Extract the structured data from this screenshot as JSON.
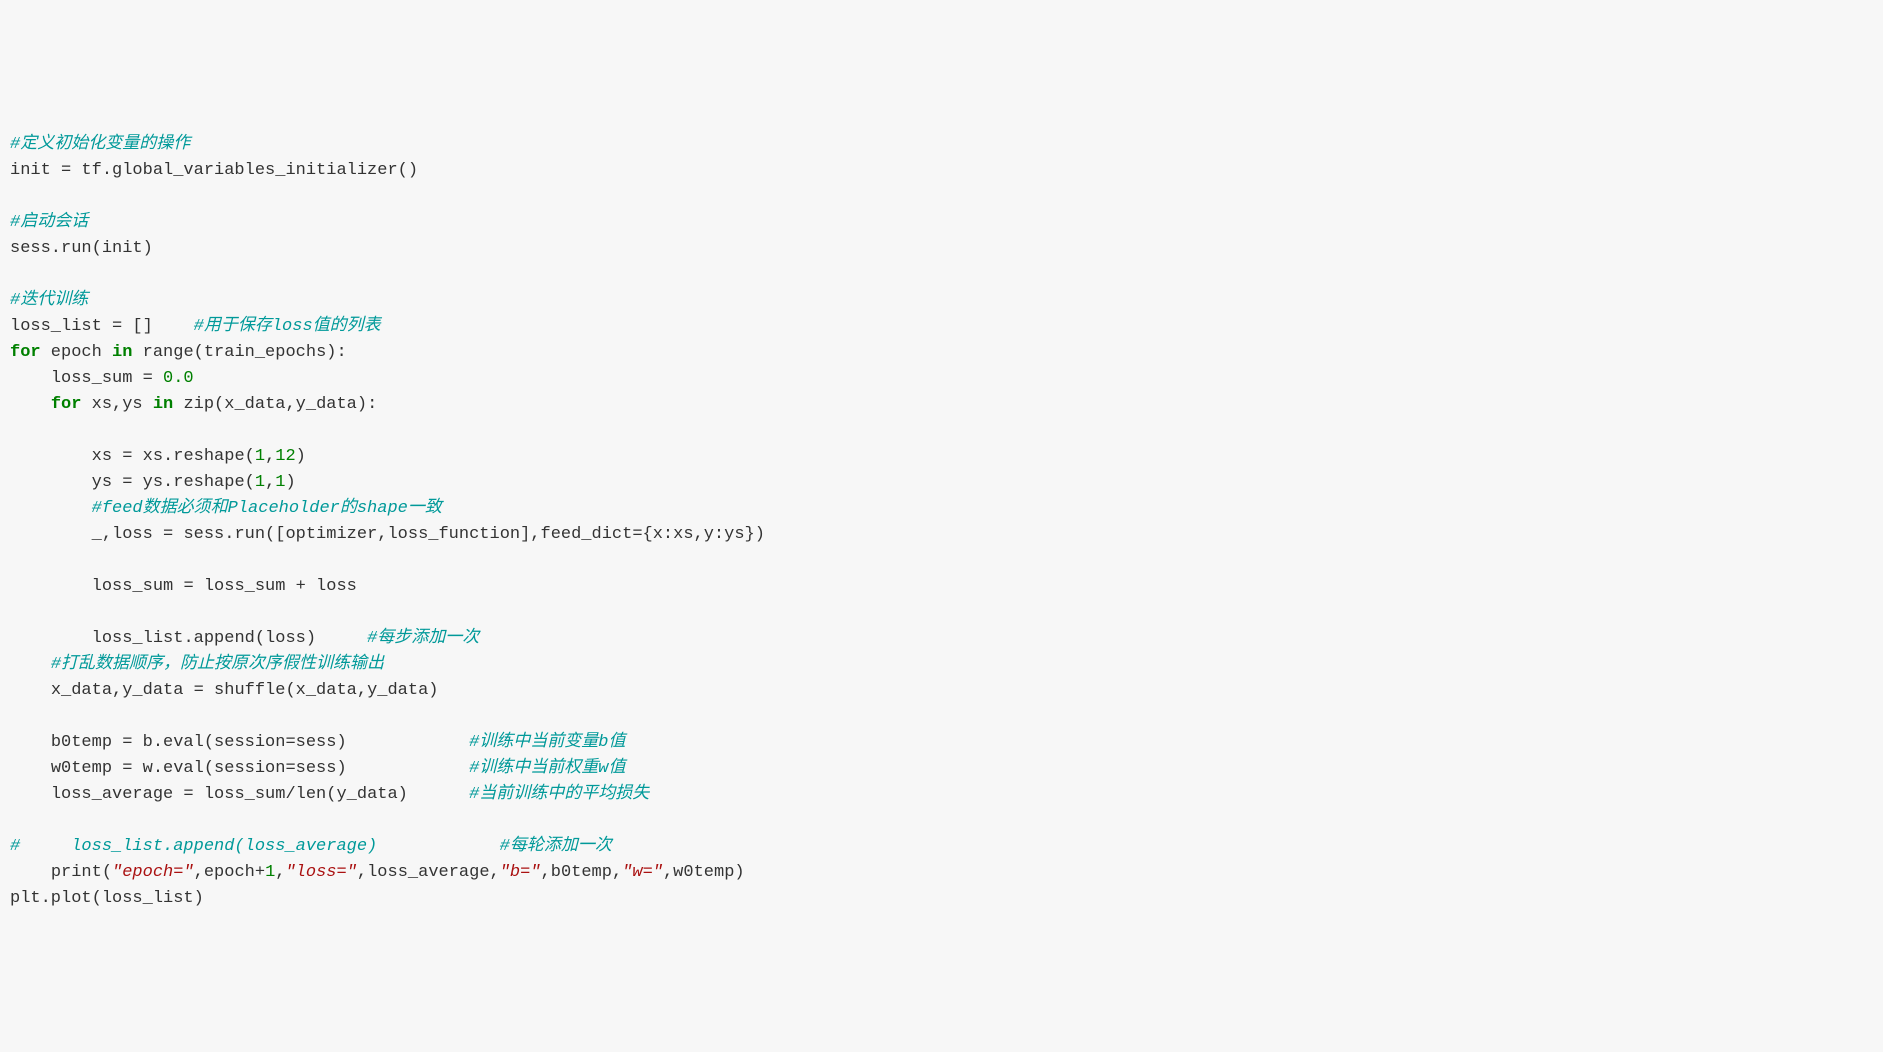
{
  "code": {
    "lines": [
      {
        "indent": 0,
        "tokens": [
          {
            "cls": "tok-comment",
            "text": "#定义初始化变量的操作"
          }
        ]
      },
      {
        "indent": 0,
        "tokens": [
          {
            "cls": "tok-plain",
            "text": "init = tf.global_variables_initializer()"
          }
        ]
      },
      {
        "indent": 0,
        "tokens": []
      },
      {
        "indent": 0,
        "tokens": [
          {
            "cls": "tok-comment",
            "text": "#启动会话"
          }
        ]
      },
      {
        "indent": 0,
        "tokens": [
          {
            "cls": "tok-plain",
            "text": "sess.run(init)"
          }
        ]
      },
      {
        "indent": 0,
        "tokens": []
      },
      {
        "indent": 0,
        "tokens": [
          {
            "cls": "tok-comment",
            "text": "#迭代训练"
          }
        ]
      },
      {
        "indent": 0,
        "tokens": [
          {
            "cls": "tok-plain",
            "text": "loss_list = []    "
          },
          {
            "cls": "tok-comment",
            "text": "#用于保存loss值的列表"
          }
        ]
      },
      {
        "indent": 0,
        "tokens": [
          {
            "cls": "tok-keyword",
            "text": "for"
          },
          {
            "cls": "tok-plain",
            "text": " epoch "
          },
          {
            "cls": "tok-keyword",
            "text": "in"
          },
          {
            "cls": "tok-plain",
            "text": " range(train_epochs):"
          }
        ]
      },
      {
        "indent": 1,
        "tokens": [
          {
            "cls": "tok-plain",
            "text": "loss_sum = "
          },
          {
            "cls": "tok-number",
            "text": "0.0"
          }
        ]
      },
      {
        "indent": 1,
        "tokens": [
          {
            "cls": "tok-keyword",
            "text": "for"
          },
          {
            "cls": "tok-plain",
            "text": " xs,ys "
          },
          {
            "cls": "tok-keyword",
            "text": "in"
          },
          {
            "cls": "tok-plain",
            "text": " zip(x_data,y_data):"
          }
        ]
      },
      {
        "indent": 0,
        "tokens": []
      },
      {
        "indent": 2,
        "tokens": [
          {
            "cls": "tok-plain",
            "text": "xs = xs.reshape("
          },
          {
            "cls": "tok-number",
            "text": "1"
          },
          {
            "cls": "tok-plain",
            "text": ","
          },
          {
            "cls": "tok-number",
            "text": "12"
          },
          {
            "cls": "tok-plain",
            "text": ")"
          }
        ]
      },
      {
        "indent": 2,
        "tokens": [
          {
            "cls": "tok-plain",
            "text": "ys = ys.reshape("
          },
          {
            "cls": "tok-number",
            "text": "1"
          },
          {
            "cls": "tok-plain",
            "text": ","
          },
          {
            "cls": "tok-number",
            "text": "1"
          },
          {
            "cls": "tok-plain",
            "text": ")"
          }
        ]
      },
      {
        "indent": 2,
        "tokens": [
          {
            "cls": "tok-comment",
            "text": "#feed数据必须和Placeholder的shape一致"
          }
        ]
      },
      {
        "indent": 2,
        "tokens": [
          {
            "cls": "tok-plain",
            "text": "_,loss = sess.run([optimizer,loss_function],feed_dict={x:xs,y:ys})"
          }
        ]
      },
      {
        "indent": 0,
        "tokens": []
      },
      {
        "indent": 2,
        "tokens": [
          {
            "cls": "tok-plain",
            "text": "loss_sum = loss_sum + loss"
          }
        ]
      },
      {
        "indent": 0,
        "tokens": []
      },
      {
        "indent": 2,
        "tokens": [
          {
            "cls": "tok-plain",
            "text": "loss_list.append(loss)     "
          },
          {
            "cls": "tok-comment",
            "text": "#每步添加一次"
          }
        ]
      },
      {
        "indent": 1,
        "tokens": [
          {
            "cls": "tok-comment",
            "text": "#打乱数据顺序，防止按原次序假性训练输出"
          }
        ]
      },
      {
        "indent": 1,
        "tokens": [
          {
            "cls": "tok-plain",
            "text": "x_data,y_data = shuffle(x_data,y_data)"
          }
        ]
      },
      {
        "indent": 0,
        "tokens": []
      },
      {
        "indent": 1,
        "tokens": [
          {
            "cls": "tok-plain",
            "text": "b0temp = b.eval(session=sess)            "
          },
          {
            "cls": "tok-comment",
            "text": "#训练中当前变量b值"
          }
        ]
      },
      {
        "indent": 1,
        "tokens": [
          {
            "cls": "tok-plain",
            "text": "w0temp = w.eval(session=sess)            "
          },
          {
            "cls": "tok-comment",
            "text": "#训练中当前权重w值"
          }
        ]
      },
      {
        "indent": 1,
        "tokens": [
          {
            "cls": "tok-plain",
            "text": "loss_average = loss_sum/len(y_data)      "
          },
          {
            "cls": "tok-comment",
            "text": "#当前训练中的平均损失"
          }
        ]
      },
      {
        "indent": 0,
        "tokens": []
      },
      {
        "indent": 0,
        "tokens": [
          {
            "cls": "tok-comment",
            "text": "#     loss_list.append(loss_average)            #每轮添加一次"
          }
        ]
      },
      {
        "indent": 1,
        "tokens": [
          {
            "cls": "tok-plain",
            "text": "print("
          },
          {
            "cls": "tok-string",
            "text": "\"epoch=\""
          },
          {
            "cls": "tok-plain",
            "text": ",epoch+"
          },
          {
            "cls": "tok-number",
            "text": "1"
          },
          {
            "cls": "tok-plain",
            "text": ","
          },
          {
            "cls": "tok-string",
            "text": "\"loss=\""
          },
          {
            "cls": "tok-plain",
            "text": ",loss_average,"
          },
          {
            "cls": "tok-string",
            "text": "\"b=\""
          },
          {
            "cls": "tok-plain",
            "text": ",b0temp,"
          },
          {
            "cls": "tok-string",
            "text": "\"w=\""
          },
          {
            "cls": "tok-plain",
            "text": ",w0temp)"
          }
        ]
      },
      {
        "indent": 0,
        "tokens": [
          {
            "cls": "tok-plain",
            "text": "plt.plot(loss_list)"
          }
        ]
      }
    ]
  },
  "indent_unit": "    "
}
